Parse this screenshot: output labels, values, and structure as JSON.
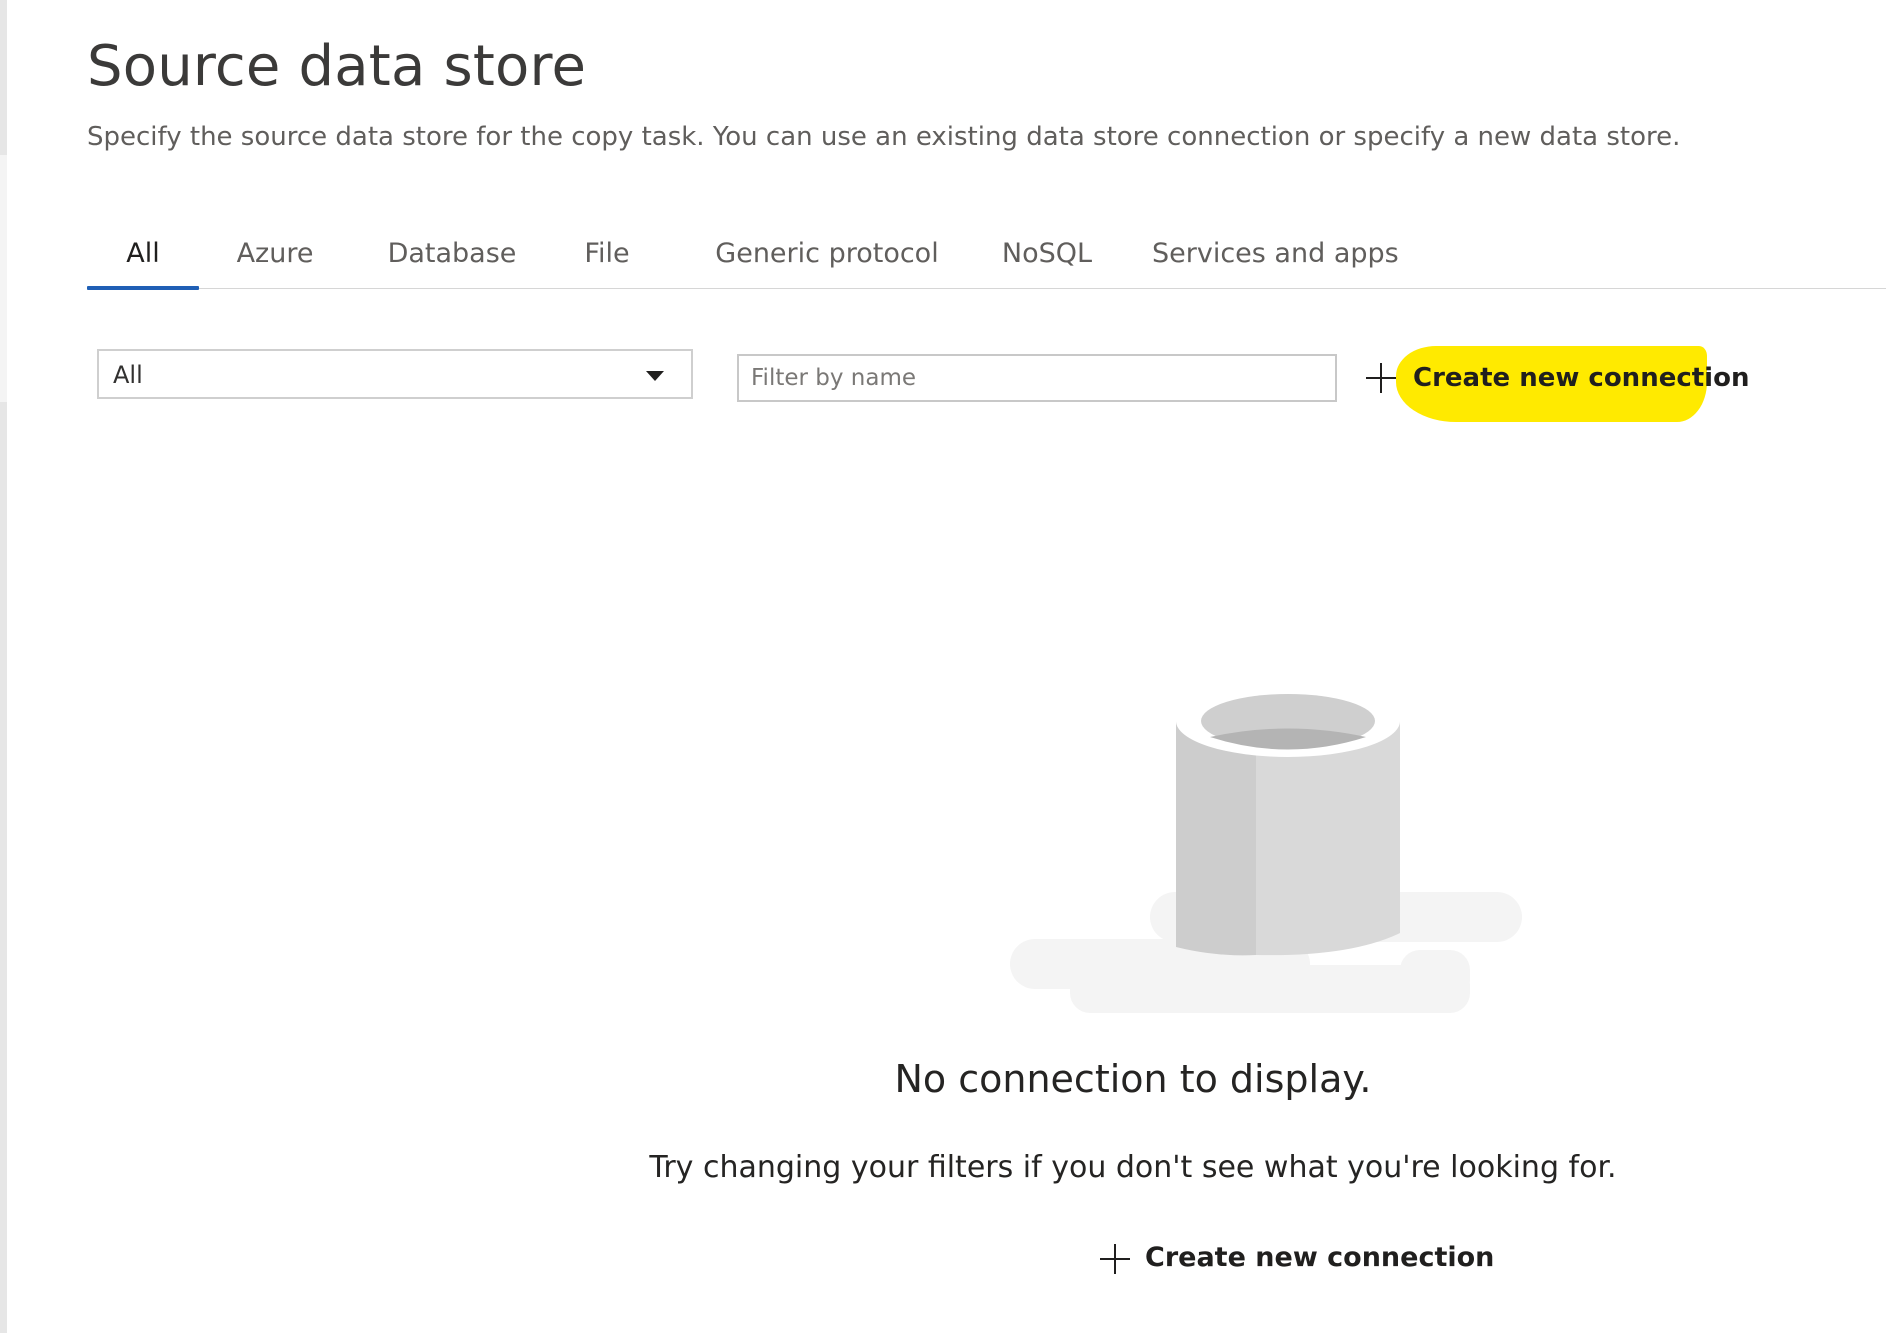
{
  "header": {
    "title": "Source data store",
    "subtitle": "Specify the source data store for the copy task. You can use an existing data store connection or specify a new data store."
  },
  "tabs": [
    {
      "label": "All",
      "active": true
    },
    {
      "label": "Azure",
      "active": false
    },
    {
      "label": "Database",
      "active": false
    },
    {
      "label": "File",
      "active": false
    },
    {
      "label": "Generic protocol",
      "active": false
    },
    {
      "label": "NoSQL",
      "active": false
    },
    {
      "label": "Services and apps",
      "active": false
    }
  ],
  "filters": {
    "type_select": {
      "value": "All"
    },
    "name_filter": {
      "placeholder": "Filter by name",
      "value": ""
    }
  },
  "toolbar": {
    "create_label": "Create new connection",
    "highlight_color": "#ffea00"
  },
  "empty_state": {
    "icon": "database-cylinder-icon",
    "title": "No connection to display.",
    "message": "Try changing your filters if you don't see what you're looking for.",
    "create_label": "Create new connection"
  },
  "colors": {
    "accent": "#1f5fb5",
    "text": "#323130",
    "muted": "#605e5c"
  }
}
